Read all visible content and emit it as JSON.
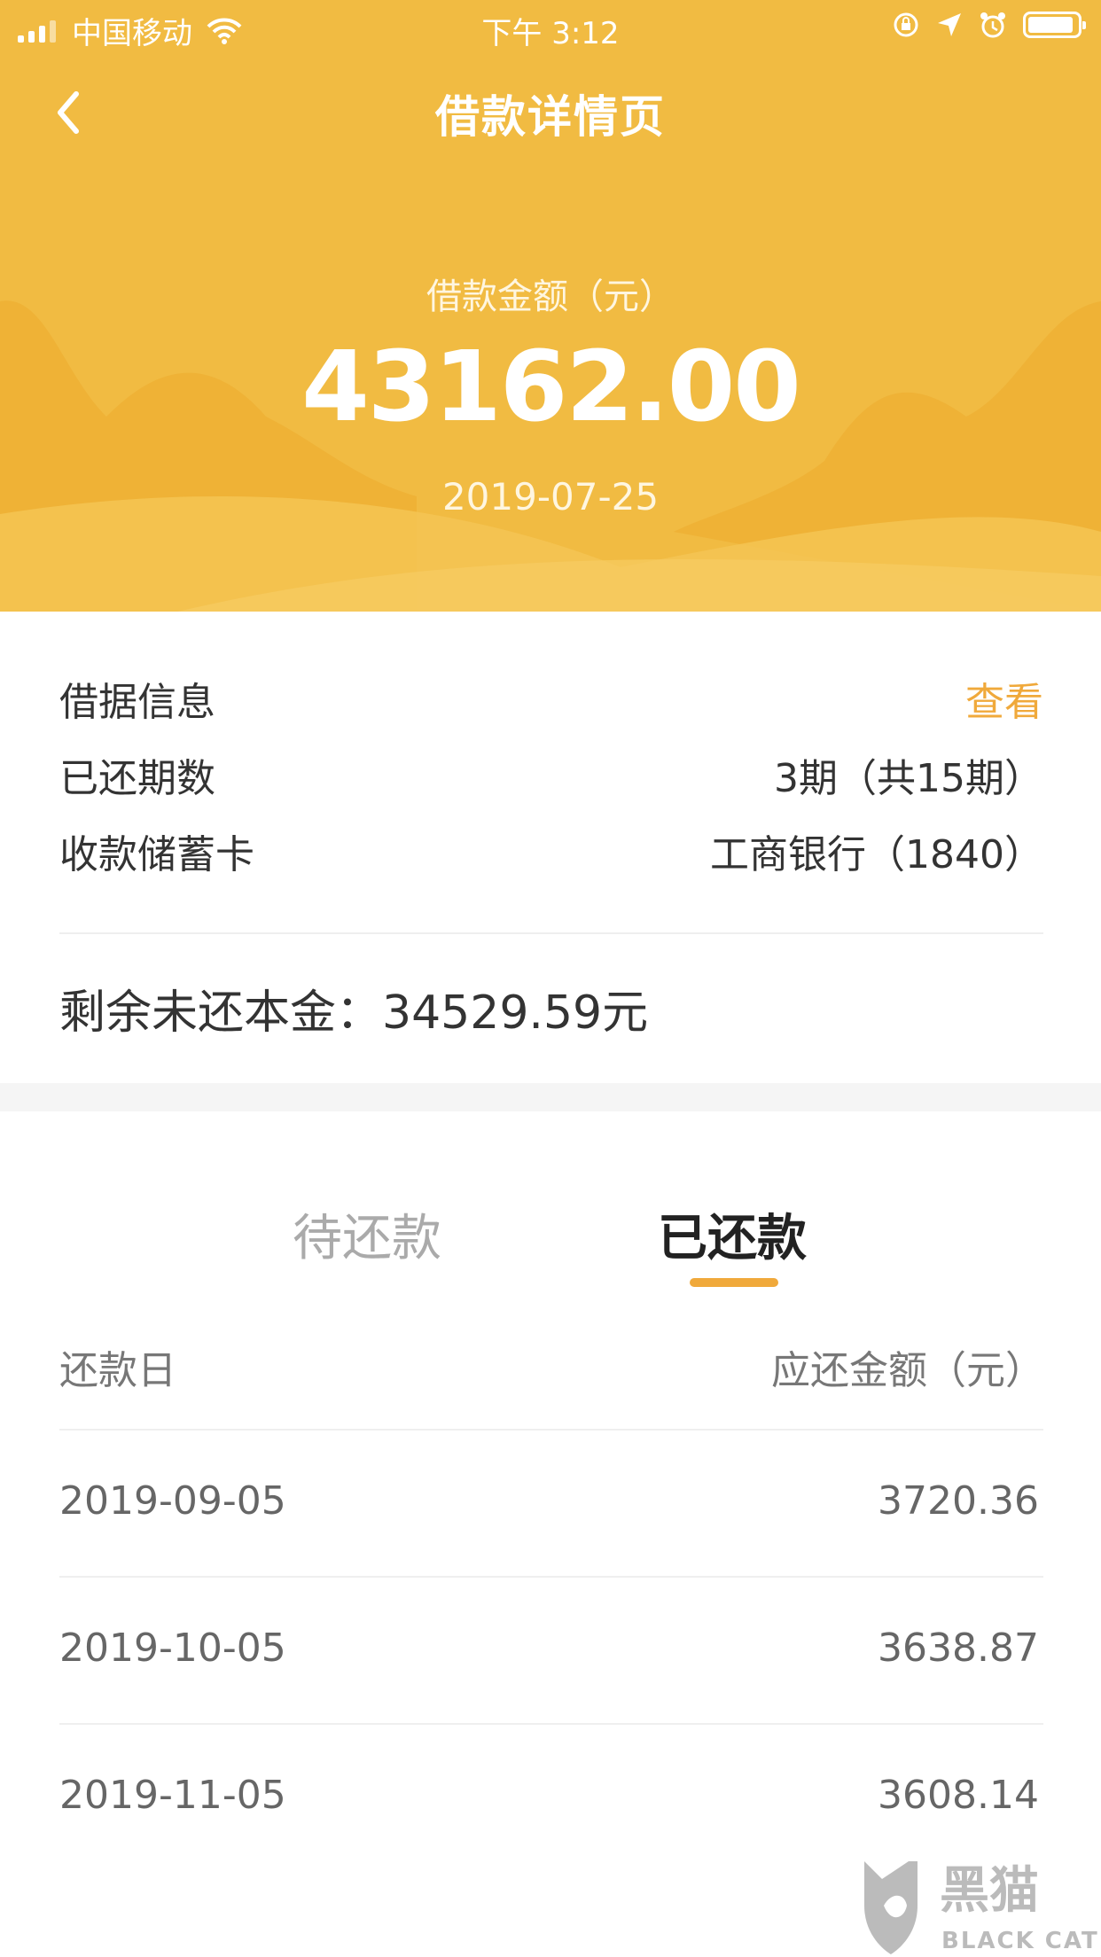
{
  "status_bar": {
    "carrier": "中国移动",
    "time": "下午 3:12"
  },
  "header": {
    "title": "借款详情页",
    "amount_label": "借款金额（元）",
    "amount": "43162.00",
    "date": "2019-07-25",
    "background_color": "#f1bb42"
  },
  "info": {
    "receipt_label": "借据信息",
    "receipt_action": "查看",
    "periods_label": "已还期数",
    "periods_value": "3期（共15期）",
    "card_label": "收款储蓄卡",
    "card_value": "工商银行（1840）",
    "remaining": "剩余未还本金：34529.59元",
    "accent_color": "#f0a93b"
  },
  "tabs": {
    "pending": "待还款",
    "paid": "已还款",
    "selected": "已还款"
  },
  "table": {
    "headers": {
      "date": "还款日",
      "amount": "应还金额（元）"
    },
    "rows": [
      {
        "date": "2019-09-05",
        "amount": "3720.36"
      },
      {
        "date": "2019-10-05",
        "amount": "3638.87"
      },
      {
        "date": "2019-11-05",
        "amount": "3608.14"
      }
    ]
  },
  "watermark": {
    "text": "黑猫",
    "subtext": "BLACK CAT"
  }
}
